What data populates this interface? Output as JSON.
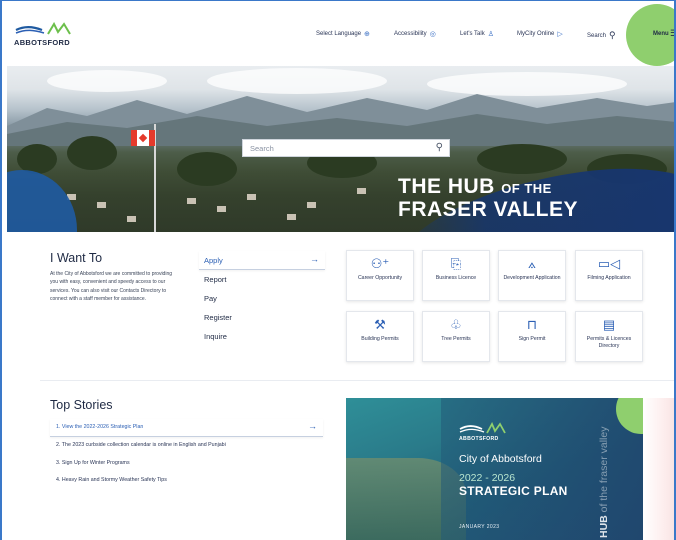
{
  "header": {
    "logo_text": "ABBOTSFORD",
    "nav": [
      {
        "label": "Select Language",
        "icon": "globe-icon"
      },
      {
        "label": "Accessibility",
        "icon": "accessibility-icon"
      },
      {
        "label": "Let's Talk",
        "icon": "person-icon"
      },
      {
        "label": "MyCity Online",
        "icon": "cursor-icon"
      },
      {
        "label": "Search",
        "icon": "search-icon"
      }
    ],
    "menu_label": "Menu"
  },
  "hero": {
    "search_placeholder": "Search",
    "headline_line1": "THE HUB",
    "headline_of_the": "OF THE",
    "headline_line2": "FRASER VALLEY"
  },
  "i_want_to": {
    "title": "I Want To",
    "description": "At the City of Abbotsford we are committed to providing you with easy, convenient and speedy access to our services. You can also visit our Contacts Directory to connect with a staff member for assistance.",
    "items": [
      "Apply",
      "Report",
      "Pay",
      "Register",
      "Inquire"
    ],
    "active_index": 0
  },
  "tiles": [
    {
      "label": "Career Opportunity",
      "icon": "person-add-icon"
    },
    {
      "label": "Business Licence",
      "icon": "license-icon"
    },
    {
      "label": "Development Application",
      "icon": "compass-icon"
    },
    {
      "label": "Filming Application",
      "icon": "video-camera-icon"
    },
    {
      "label": "Building Permits",
      "icon": "worker-icon"
    },
    {
      "label": "Tree Permits",
      "icon": "tree-icon"
    },
    {
      "label": "Sign Permit",
      "icon": "sign-icon"
    },
    {
      "label": "Permits & Licences Directory",
      "icon": "directory-icon"
    }
  ],
  "top_stories": {
    "title": "Top Stories",
    "items": [
      "1.  View the 2022-2026 Strategic Plan",
      "2.  The 2023 curbside collection calendar is online in English and Punjabi",
      "3.  Sign Up for Winter Programs",
      "4.  Heavy Rain and Stormy Weather Safety Tips"
    ]
  },
  "strategic_plan": {
    "logo_text": "ABBOTSFORD",
    "city": "City of Abbotsford",
    "years": "2022 - 2026",
    "plan": "STRATEGIC PLAN",
    "date": "JANUARY 2023",
    "vertical_bold": "HUB",
    "vertical_rest": " of the fraser valley"
  },
  "colors": {
    "accent_blue": "#2b5fb4",
    "menu_green": "#8fcf6e",
    "navy": "#1f2a44"
  }
}
